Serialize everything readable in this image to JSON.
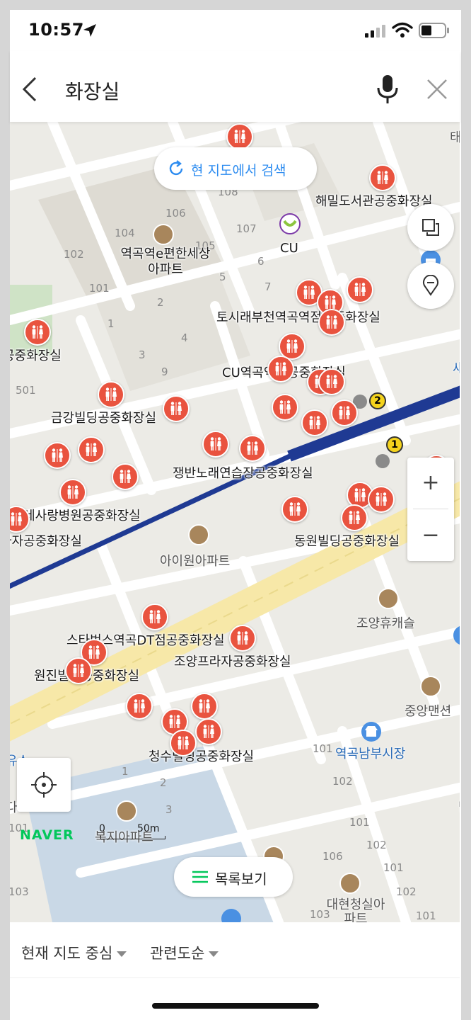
{
  "status": {
    "time": "10:57"
  },
  "search": {
    "query": "화장실"
  },
  "map": {
    "research_button": "현 지도에서 검색",
    "list_button": "목록보기",
    "naver_logo": "NAVER",
    "scale": {
      "zero": "0",
      "distance": "50m"
    },
    "place_labels": [
      "해밀도서관공중화장실",
      "역곡역e편한세상아파트",
      "CU",
      "토시래부천역곡역점공중화장실",
      "공중화장실",
      "CU역곡역점공중화장실",
      "금강빌딩공중화장실",
      "쟁반노래연습장공중화장실",
      "천연세사랑병원공중화장실",
      "라자공중화장실",
      "아이원아파트",
      "동원빌딩공중화장실",
      "조양휴캐슬",
      "스타벅스역곡DT점공중화장실",
      "조양프라자공중화장실",
      "원진빌딩공중화장실",
      "중앙맨션",
      "역곡남부시장",
      "청수빌딩공중화장실",
      "복지아파트",
      "대현청실아파트"
    ],
    "edge_labels": [
      "태청",
      "새마",
      "유소",
      "다",
      "남"
    ],
    "building_numbers": [
      "108",
      "106",
      "104",
      "107",
      "105",
      "102",
      "6",
      "5",
      "101",
      "7",
      "2",
      "1",
      "4",
      "3",
      "9",
      "501",
      "1",
      "2",
      "3",
      "106",
      "101",
      "102",
      "101",
      "102",
      "103",
      "101",
      "102",
      "101",
      "103",
      "101"
    ],
    "subway_exits": [
      "2",
      "1"
    ],
    "icons": [
      "toilet-icon",
      "apartment-icon",
      "convenience-store-icon",
      "market-icon",
      "subway-exit-icon"
    ]
  },
  "controls": {
    "zoom_in": "+",
    "zoom_out": "−"
  },
  "filters": {
    "location": "현재 지도 중심",
    "sort": "관련도순"
  },
  "colors": {
    "pin": "#e9533f",
    "subway_line": "#1f3a93",
    "main_road": "#f6e6a4",
    "accent": "#2d8cf0",
    "naver": "#03c75a"
  }
}
